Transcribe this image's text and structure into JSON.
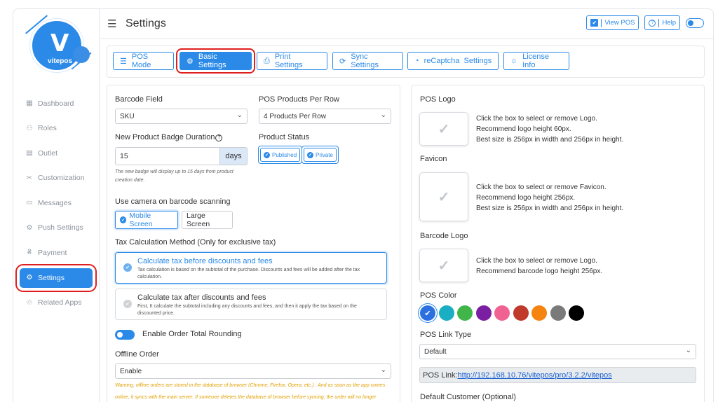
{
  "brand": {
    "name": "vitepos"
  },
  "sidebar": {
    "items": [
      {
        "label": "Dashboard",
        "icon": "dashboard-icon"
      },
      {
        "label": "Roles",
        "icon": "users-icon"
      },
      {
        "label": "Outlet",
        "icon": "outlet-icon"
      },
      {
        "label": "Customization",
        "icon": "tools-icon"
      },
      {
        "label": "Messages",
        "icon": "message-icon"
      },
      {
        "label": "Push Settings",
        "icon": "gear-icon"
      },
      {
        "label": "Payment",
        "icon": "payment-icon"
      },
      {
        "label": "Settings",
        "icon": "gear-icon",
        "active": true
      },
      {
        "label": "Related Apps",
        "icon": "apps-icon"
      }
    ]
  },
  "header": {
    "title": "Settings",
    "view_pos": "View POS",
    "help": "Help"
  },
  "tabs": [
    {
      "label": "POS Mode"
    },
    {
      "label": "Basic Settings",
      "active": true
    },
    {
      "label": "Print Settings"
    },
    {
      "label": "Sync Settings"
    },
    {
      "label": "reCaptcha  Settings"
    },
    {
      "label": "License Info"
    }
  ],
  "form": {
    "barcode_field": {
      "label": "Barcode Field",
      "value": "SKU"
    },
    "products_per_row": {
      "label": "POS Products Per Row",
      "value": "4 Products Per Row"
    },
    "badge_duration": {
      "label": "New Product Badge Duration",
      "help_glyph": "?",
      "value": "15",
      "unit": "days",
      "note": "The new badge will display up to 15 days from product creation date."
    },
    "product_status": {
      "label": "Product Status",
      "options": [
        "Published",
        "Private"
      ]
    },
    "camera": {
      "label": "Use camera on barcode scanning",
      "options": [
        "Mobile Screen",
        "Large Screen"
      ],
      "selected": "Mobile Screen"
    },
    "tax_method": {
      "label": "Tax Calculation Method (Only for exclusive tax)",
      "options": [
        {
          "title": "Calculate tax before discounts and fees",
          "desc": "Tax calculation is based on the subtotal of the purchase. Discounts and fees will be added after the tax calculation.",
          "selected": true
        },
        {
          "title": "Calculate tax after discounts and fees",
          "desc": "First, It calculate the subtotal including any discounts and fees, and then it apply the tax based on the discounted price.",
          "selected": false
        }
      ]
    },
    "rounding": {
      "label": "Enable Order Total Rounding",
      "on": true
    },
    "offline_order": {
      "label": "Offline Order",
      "value": "Enable",
      "warning_1": "Warning, offline orders are stored in the database of browser (Chrome, Firefox, Opera, etc.) . And as soon as the app comes",
      "warning_2": "online, it syncs with the main server. If someone deletes the database of browser before syncing, the order will no longer"
    }
  },
  "right": {
    "pos_logo": {
      "label": "POS Logo",
      "lines": [
        "Click the box to select or remove Logo.",
        "Recommend logo height 60px.",
        "Best size is 256px in width and 256px in height."
      ]
    },
    "favicon": {
      "label": "Favicon",
      "lines": [
        "Click the box to select or remove Favicon.",
        "Recommend logo height 256px.",
        "Best size is 256px in width and 256px in height."
      ]
    },
    "barcode_logo": {
      "label": "Barcode Logo",
      "lines": [
        "Click the box to select or remove Logo.",
        "Recommend barcode logo height 256px."
      ]
    },
    "pos_color": {
      "label": "POS Color",
      "colors": [
        "#2b6fe0",
        "#1aaec4",
        "#3fb54a",
        "#7a1fa2",
        "#f06292",
        "#c0392b",
        "#f5830f",
        "#7a7a7a",
        "#000000"
      ],
      "selected_index": 0
    },
    "link_type": {
      "label": "POS Link Type",
      "value": "Default"
    },
    "pos_link": {
      "prefix": "POS Link:",
      "url": "http://192.168.10.76/vitepos/pro/3.2.2/vitepos"
    },
    "default_customer": {
      "label": "Default Customer (Optional)"
    }
  }
}
